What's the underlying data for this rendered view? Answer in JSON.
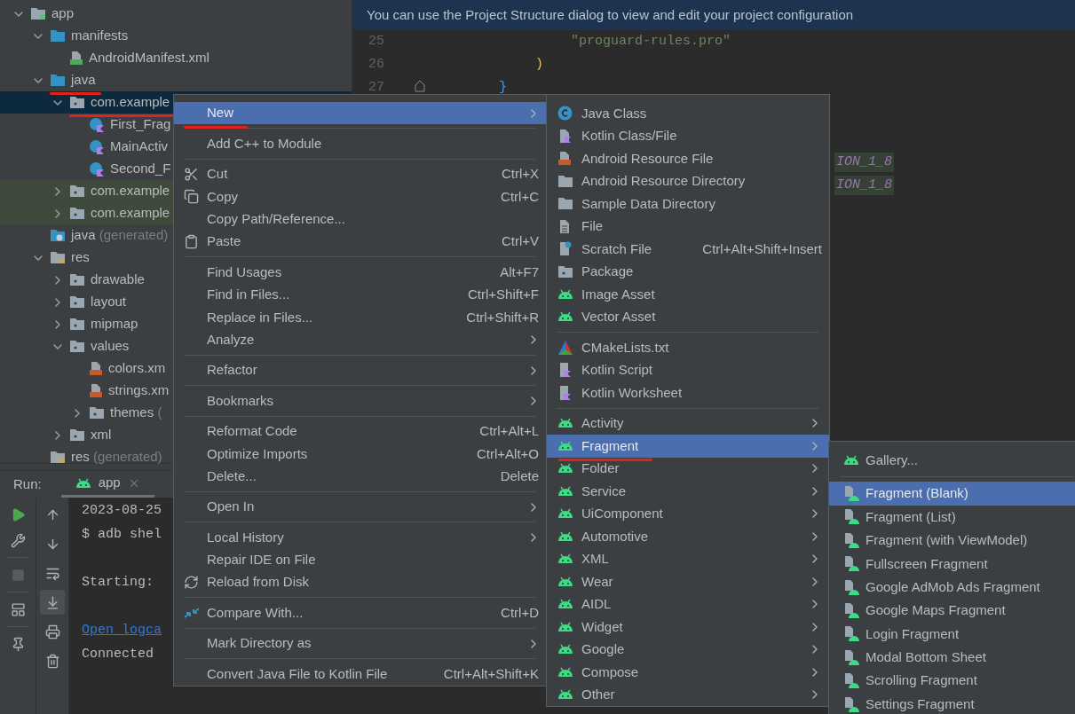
{
  "project_tree": {
    "items": [
      {
        "label": "app",
        "kind": "module",
        "expanded": true,
        "selected": false,
        "children": [
          {
            "label": "manifests",
            "kind": "source-root",
            "expanded": true,
            "selected": false,
            "children": [
              {
                "label": "AndroidManifest.xml",
                "kind": "manifest",
                "selected": false
              }
            ]
          },
          {
            "label": "java",
            "kind": "source-root",
            "expanded": true,
            "selected": false,
            "annotated": true,
            "children": [
              {
                "label": "com.example",
                "kind": "package",
                "expanded": true,
                "selected": true,
                "annotated": true,
                "children": [
                  {
                    "label": "First_Frag",
                    "kind": "kotlin-class",
                    "selected": false
                  },
                  {
                    "label": "MainActiv",
                    "kind": "kotlin-class",
                    "selected": false
                  },
                  {
                    "label": "Second_F",
                    "kind": "kotlin-class",
                    "selected": false
                  }
                ]
              },
              {
                "label": "com.example",
                "kind": "package",
                "expanded": false,
                "selected": false,
                "highlighted": true
              },
              {
                "label": "com.example",
                "kind": "package",
                "expanded": false,
                "selected": false,
                "highlighted": true
              }
            ]
          },
          {
            "label": "java",
            "suffix": "(generated)",
            "kind": "generated-root",
            "selected": false
          },
          {
            "label": "res",
            "kind": "resource-root",
            "expanded": true,
            "selected": false,
            "children": [
              {
                "label": "drawable",
                "kind": "package",
                "expanded": false,
                "selected": false
              },
              {
                "label": "layout",
                "kind": "package",
                "expanded": false,
                "selected": false
              },
              {
                "label": "mipmap",
                "kind": "package",
                "expanded": false,
                "selected": false
              },
              {
                "label": "values",
                "kind": "package",
                "expanded": true,
                "selected": false,
                "children": [
                  {
                    "label": "colors.xm",
                    "kind": "xml-value",
                    "selected": false
                  },
                  {
                    "label": "strings.xm",
                    "kind": "xml-value",
                    "selected": false
                  },
                  {
                    "label": "themes",
                    "suffix": "(",
                    "kind": "package",
                    "expanded": false,
                    "selected": false
                  }
                ]
              },
              {
                "label": "xml",
                "kind": "package",
                "expanded": false,
                "selected": false
              }
            ]
          },
          {
            "label": "res",
            "suffix": "(generated)",
            "kind": "resource-root",
            "selected": false
          }
        ]
      }
    ]
  },
  "editor": {
    "banner": "You can use the Project Structure dialog to view and edit your project configuration",
    "lines": [
      {
        "number": "25",
        "kind": "string",
        "text": "\"proguard-rules.pro\""
      },
      {
        "number": "26",
        "kind": "paren",
        "text": ")"
      },
      {
        "number": "27",
        "kind": "brace",
        "text": "}"
      }
    ],
    "lower_lines": [
      {
        "kind": "constant",
        "text": "ION_1_8"
      },
      {
        "kind": "constant",
        "text": "ION_1_8"
      }
    ]
  },
  "run_panel": {
    "label": "Run:",
    "tabs": [
      {
        "label": "app",
        "selected": true
      }
    ],
    "stop_enabled": false,
    "scroll_to_end": true,
    "console": [
      {
        "kind": "text",
        "text": "2023-08-25"
      },
      {
        "kind": "text",
        "text": "$ adb shel"
      },
      {
        "kind": "blank"
      },
      {
        "kind": "text",
        "text": "Starting:"
      },
      {
        "kind": "blank"
      },
      {
        "kind": "link",
        "text": "Open logca"
      },
      {
        "kind": "text",
        "text": "Connected"
      }
    ]
  },
  "menus": [
    {
      "items": [
        {
          "label": "New",
          "submenu": true,
          "selected": true,
          "annotated": true
        },
        {
          "label": "Add C++ to Module",
          "selected": false,
          "separator_before": true
        },
        {
          "label": "Cut",
          "shortcut": "Ctrl+X",
          "selected": false,
          "separator_before": true
        },
        {
          "label": "Copy",
          "shortcut": "Ctrl+C",
          "selected": false
        },
        {
          "label": "Copy Path/Reference...",
          "selected": false
        },
        {
          "label": "Paste",
          "shortcut": "Ctrl+V",
          "selected": false
        },
        {
          "label": "Find Usages",
          "shortcut": "Alt+F7",
          "selected": false,
          "separator_before": true
        },
        {
          "label": "Find in Files...",
          "shortcut": "Ctrl+Shift+F",
          "selected": false
        },
        {
          "label": "Replace in Files...",
          "shortcut": "Ctrl+Shift+R",
          "selected": false
        },
        {
          "label": "Analyze",
          "submenu": true,
          "selected": false
        },
        {
          "label": "Refactor",
          "submenu": true,
          "selected": false,
          "separator_before": true
        },
        {
          "label": "Bookmarks",
          "submenu": true,
          "selected": false,
          "separator_before": true
        },
        {
          "label": "Reformat Code",
          "shortcut": "Ctrl+Alt+L",
          "selected": false,
          "separator_before": true
        },
        {
          "label": "Optimize Imports",
          "shortcut": "Ctrl+Alt+O",
          "selected": false
        },
        {
          "label": "Delete...",
          "shortcut": "Delete",
          "selected": false
        },
        {
          "label": "Open In",
          "submenu": true,
          "selected": false,
          "separator_before": true
        },
        {
          "label": "Local History",
          "submenu": true,
          "selected": false,
          "separator_before": true
        },
        {
          "label": "Repair IDE on File",
          "selected": false
        },
        {
          "label": "Reload from Disk",
          "selected": false
        },
        {
          "label": "Compare With...",
          "shortcut": "Ctrl+D",
          "selected": false,
          "separator_before": true
        },
        {
          "label": "Mark Directory as",
          "submenu": true,
          "selected": false,
          "separator_before": true
        },
        {
          "label": "Convert Java File to Kotlin File",
          "shortcut": "Ctrl+Alt+Shift+K",
          "selected": false,
          "separator_before": true
        }
      ]
    },
    {
      "items": [
        {
          "label": "Java Class",
          "selected": false
        },
        {
          "label": "Kotlin Class/File",
          "selected": false
        },
        {
          "label": "Android Resource File",
          "selected": false
        },
        {
          "label": "Android Resource Directory",
          "selected": false
        },
        {
          "label": "Sample Data Directory",
          "selected": false
        },
        {
          "label": "File",
          "selected": false
        },
        {
          "label": "Scratch File",
          "shortcut": "Ctrl+Alt+Shift+Insert",
          "selected": false
        },
        {
          "label": "Package",
          "selected": false
        },
        {
          "label": "Image Asset",
          "selected": false
        },
        {
          "label": "Vector Asset",
          "selected": false
        },
        {
          "label": "CMakeLists.txt",
          "selected": false,
          "separator_before": true
        },
        {
          "label": "Kotlin Script",
          "selected": false
        },
        {
          "label": "Kotlin Worksheet",
          "selected": false
        },
        {
          "label": "Activity",
          "submenu": true,
          "selected": false,
          "separator_before": true
        },
        {
          "label": "Fragment",
          "submenu": true,
          "selected": true,
          "annotated": true
        },
        {
          "label": "Folder",
          "submenu": true,
          "selected": false
        },
        {
          "label": "Service",
          "submenu": true,
          "selected": false
        },
        {
          "label": "UiComponent",
          "submenu": true,
          "selected": false
        },
        {
          "label": "Automotive",
          "submenu": true,
          "selected": false
        },
        {
          "label": "XML",
          "submenu": true,
          "selected": false
        },
        {
          "label": "Wear",
          "submenu": true,
          "selected": false
        },
        {
          "label": "AIDL",
          "submenu": true,
          "selected": false
        },
        {
          "label": "Widget",
          "submenu": true,
          "selected": false
        },
        {
          "label": "Google",
          "submenu": true,
          "selected": false
        },
        {
          "label": "Compose",
          "submenu": true,
          "selected": false
        },
        {
          "label": "Other",
          "submenu": true,
          "selected": false
        }
      ]
    },
    {
      "items": [
        {
          "label": "Gallery...",
          "selected": false
        },
        {
          "label": "Fragment (Blank)",
          "selected": true,
          "separator_before": true
        },
        {
          "label": "Fragment (List)",
          "selected": false
        },
        {
          "label": "Fragment (with ViewModel)",
          "selected": false
        },
        {
          "label": "Fullscreen Fragment",
          "selected": false
        },
        {
          "label": "Google AdMob Ads Fragment",
          "selected": false
        },
        {
          "label": "Google Maps Fragment",
          "selected": false
        },
        {
          "label": "Login Fragment",
          "selected": false
        },
        {
          "label": "Modal Bottom Sheet",
          "selected": false
        },
        {
          "label": "Scrolling Fragment",
          "selected": false
        },
        {
          "label": "Settings Fragment",
          "selected": false
        }
      ]
    }
  ]
}
